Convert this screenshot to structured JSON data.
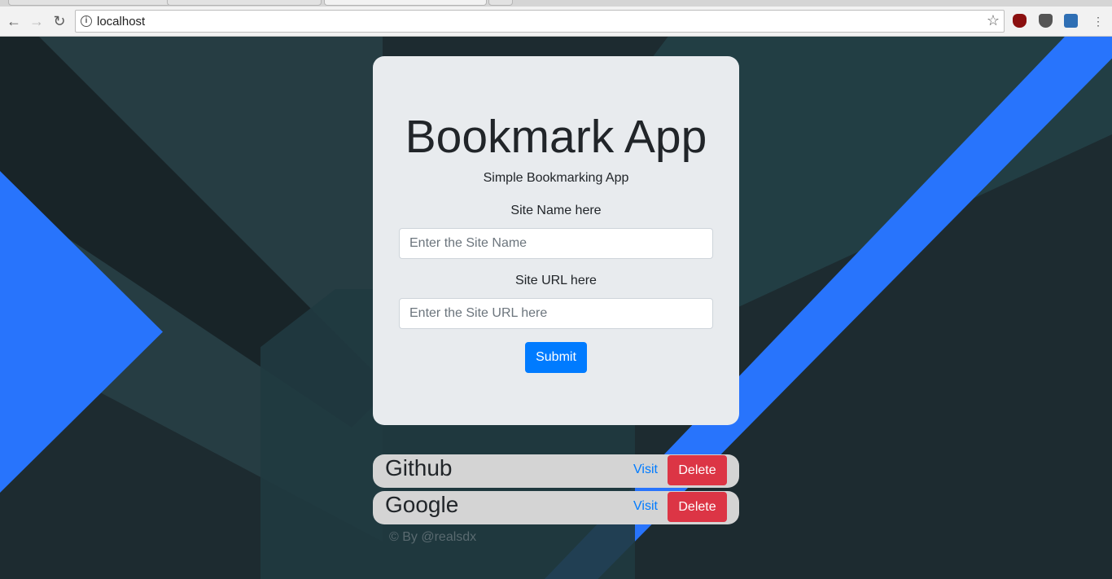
{
  "browser": {
    "url": "localhost",
    "nav": {
      "back": "←",
      "forward": "→",
      "reload": "↻"
    },
    "icons": {
      "info": "i",
      "star": "☆"
    }
  },
  "app": {
    "title": "Bookmark App",
    "subtitle": "Simple Bookmarking App",
    "site_name_label": "Site Name here",
    "site_name_placeholder": "Enter the Site Name",
    "site_url_label": "Site URL here",
    "site_url_placeholder": "Enter the Site URL here",
    "submit_label": "Submit"
  },
  "bookmarks": [
    {
      "name": "Github",
      "visit_label": "Visit",
      "delete_label": "Delete"
    },
    {
      "name": "Google",
      "visit_label": "Visit",
      "delete_label": "Delete"
    }
  ],
  "footer": "© By @realsdx",
  "colors": {
    "primary": "#007bff",
    "danger": "#dc3545",
    "card_bg": "#e8ebee",
    "bookmark_bg": "#d4d4d4",
    "accent_blue": "#2874fc"
  }
}
